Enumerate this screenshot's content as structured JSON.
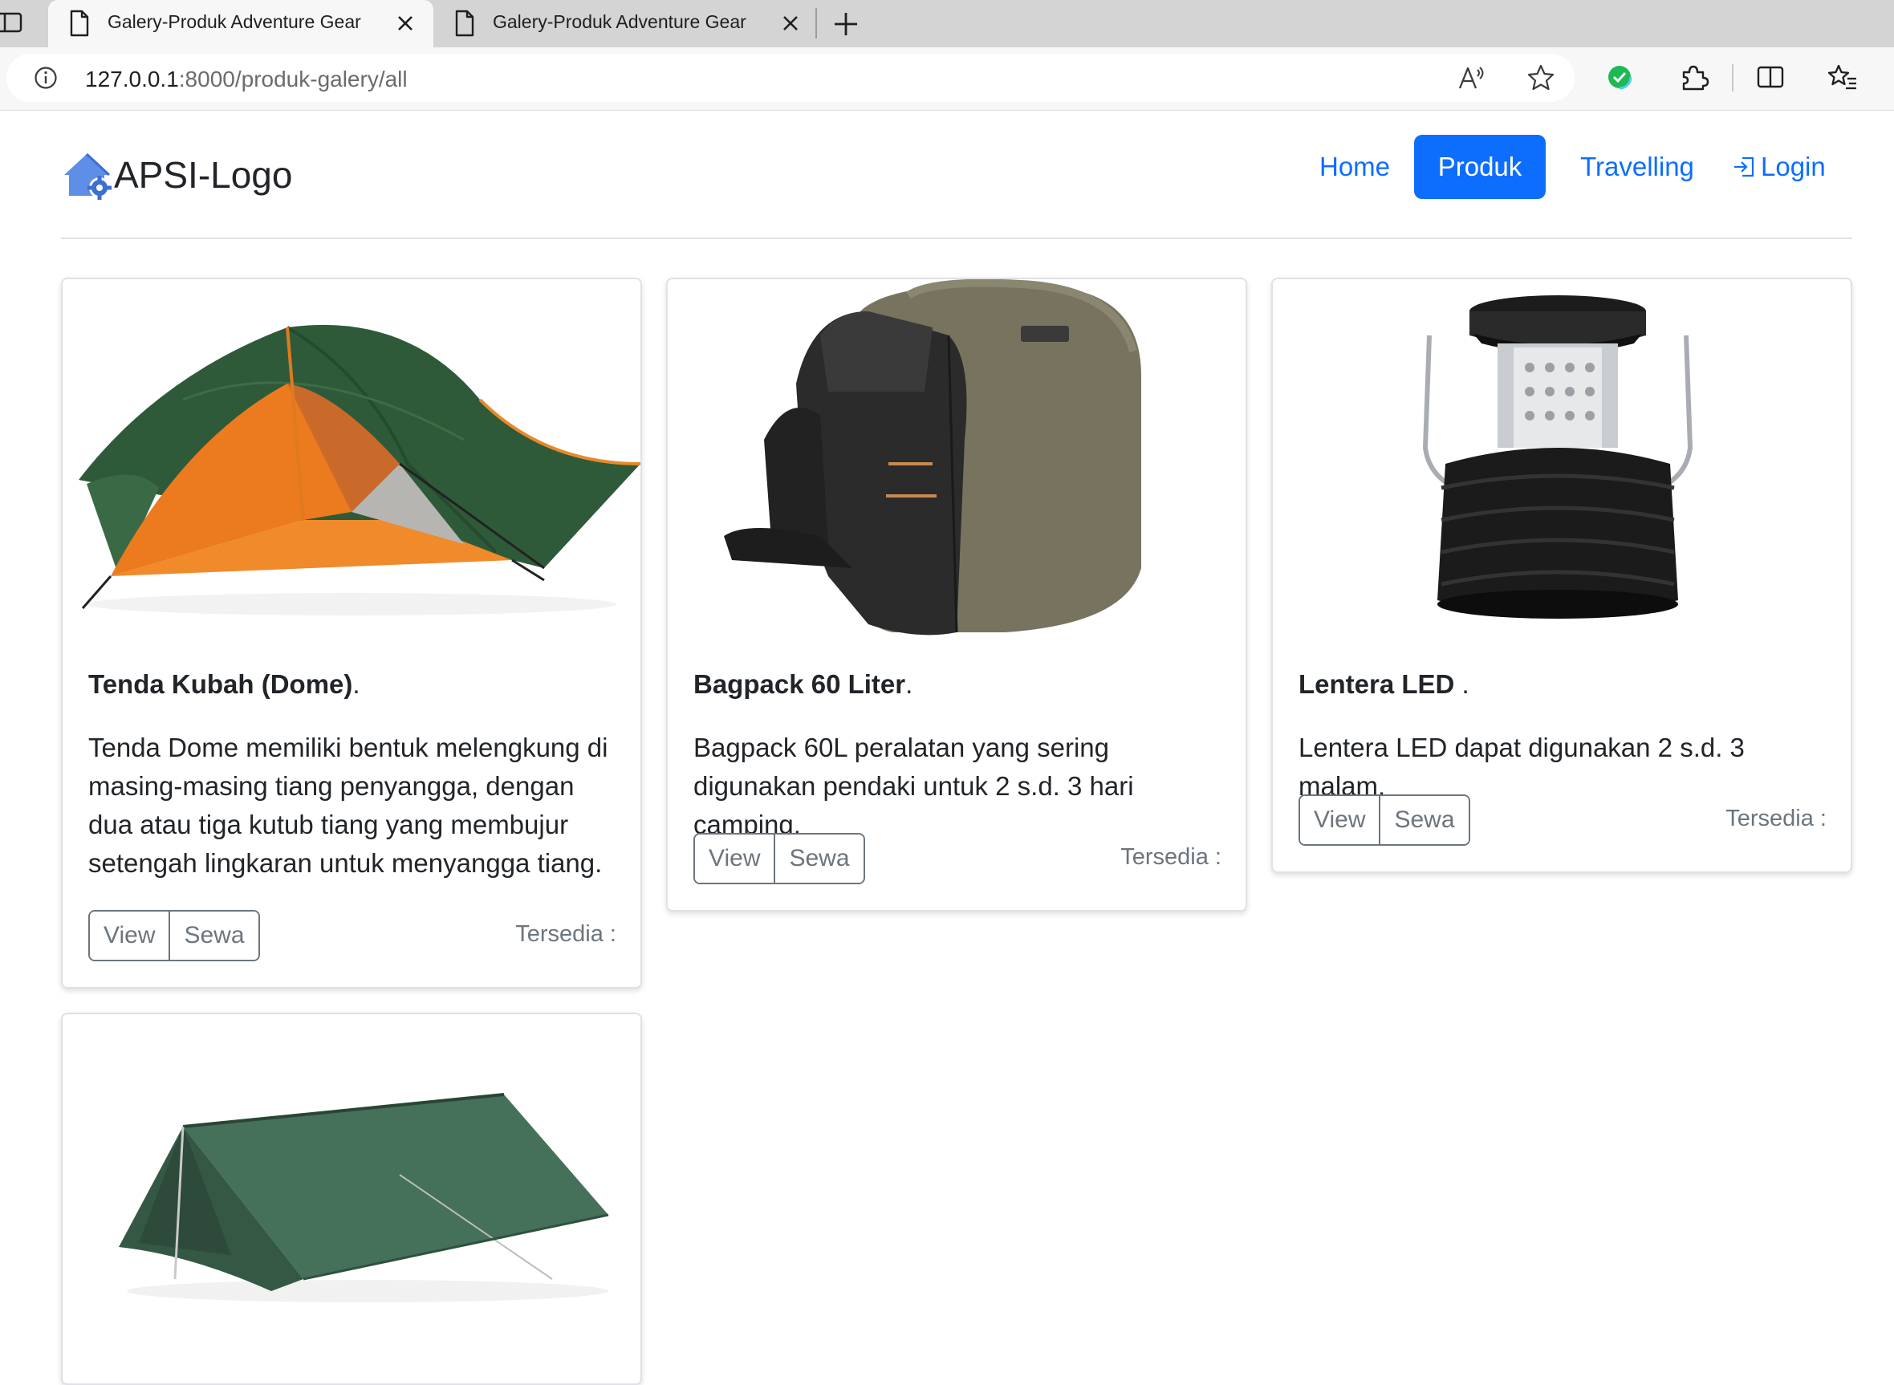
{
  "browser": {
    "tabs": [
      {
        "title": "Galery-Produk Adventure Gear",
        "active": true
      },
      {
        "title": "Galery-Produk Adventure Gear",
        "active": false
      }
    ],
    "url_host": "127.0.0.1",
    "url_path": ":8000/produk-galery/all",
    "extension_icon_color": "#1db954"
  },
  "navbar": {
    "brand": "APSI-Logo",
    "links": [
      {
        "label": "Home",
        "active": false
      },
      {
        "label": "Produk",
        "active": true
      },
      {
        "label": "Travelling",
        "active": false
      },
      {
        "label": "Login",
        "active": false,
        "icon": "login-icon"
      }
    ],
    "accent_color": "#0d6efd"
  },
  "products": [
    {
      "name": "Tenda Kubah (Dome)",
      "suffix": ".",
      "description": "Tenda Dome memiliki bentuk melengkung di masing-masing tiang penyangga, dengan dua atau tiga kutub tiang yang membujur setengah lingkaran untuk menyangga tiang.",
      "image": "dome-tent",
      "view_label": "View",
      "rent_label": "Sewa",
      "availability": "Tersedia :"
    },
    {
      "name": "Bagpack 60 Liter",
      "suffix": ".",
      "description": "Bagpack 60L peralatan yang sering digunakan pendaki untuk 2 s.d. 3 hari camping.",
      "image": "backpack",
      "view_label": "View",
      "rent_label": "Sewa",
      "availability": "Tersedia :"
    },
    {
      "name": "Lentera LED",
      "suffix": " .",
      "description": "Lentera LED dapat digunakan 2 s.d. 3 malam.",
      "image": "led-lantern",
      "view_label": "View",
      "rent_label": "Sewa",
      "availability": "Tersedia :"
    },
    {
      "name": "",
      "image": "ridge-tent"
    }
  ]
}
